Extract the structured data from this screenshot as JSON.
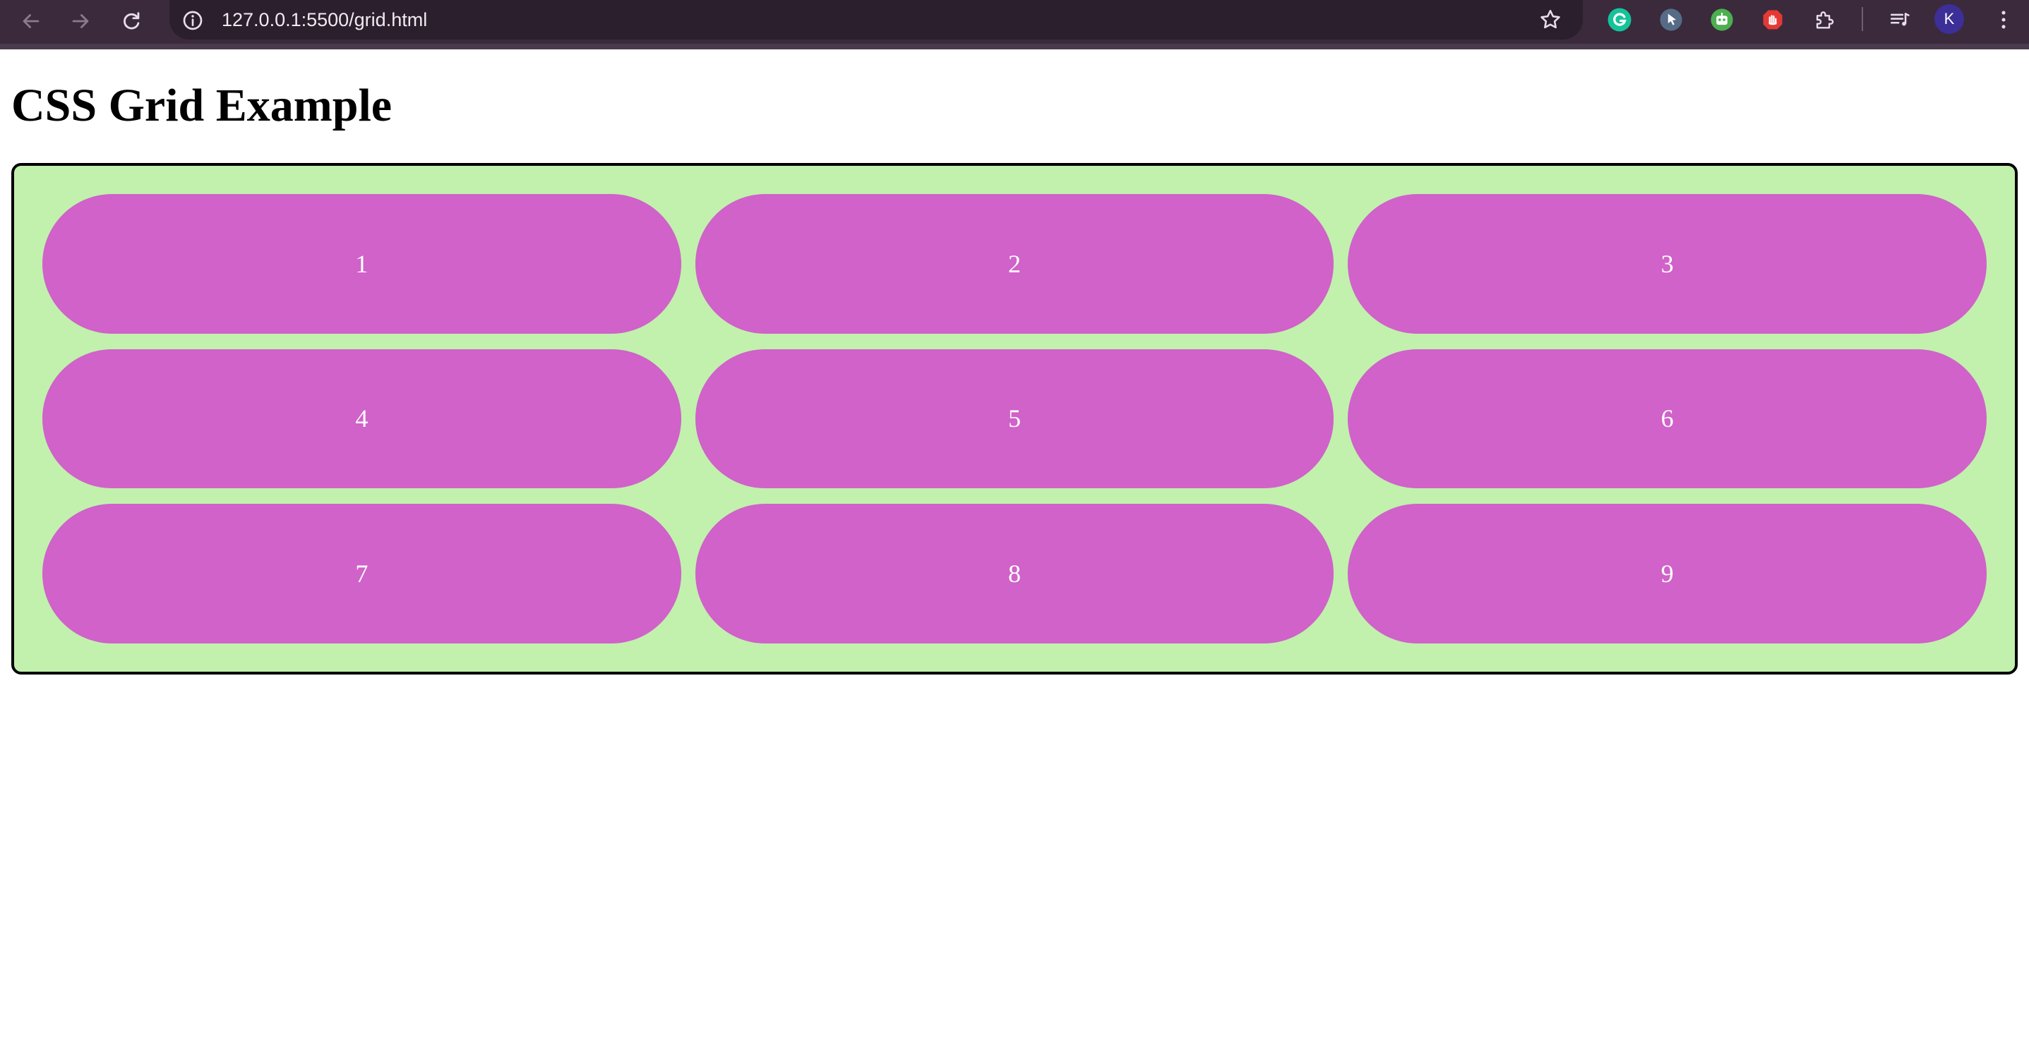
{
  "browser": {
    "url": "127.0.0.1:5500/grid.html",
    "avatar_initial": "K",
    "icons": [
      "back-arrow-icon",
      "forward-arrow-icon",
      "reload-icon",
      "site-info-icon",
      "bookmark-star-icon",
      "grammarly-extension-icon",
      "cursor-extension-icon",
      "robot-extension-icon",
      "stop-hand-extension-icon",
      "extensions-puzzle-icon",
      "media-queue-icon",
      "more-menu-icon"
    ]
  },
  "page": {
    "title": "CSS Grid Example",
    "grid_items": [
      "1",
      "2",
      "3",
      "4",
      "5",
      "6",
      "7",
      "8",
      "9"
    ]
  },
  "colors": {
    "chrome_bar": "#3a2a3c",
    "omnibox": "#2b1f2d",
    "grid_background": "#c1f1ad",
    "grid_border": "#000000",
    "item_background": "#d062c9",
    "item_text": "#ffffff",
    "avatar": "#3c2f97"
  }
}
